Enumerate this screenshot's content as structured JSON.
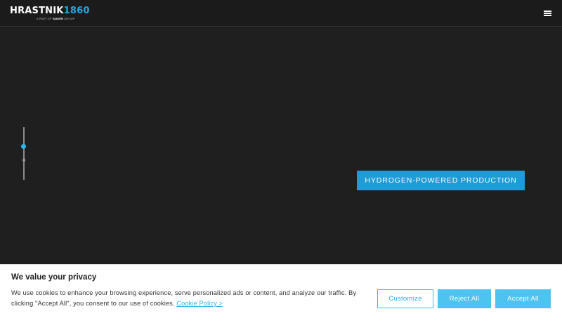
{
  "header": {
    "logo_word": "HRASTNIK",
    "logo_year": "1860",
    "logo_sub_before": "A PART OF ",
    "logo_sub_brand": "VAIDER",
    "logo_sub_after": " GROUP",
    "menu_icon": "hamburger-menu-icon"
  },
  "hero": {
    "button_label": "HYDROGEN-POWERED PRODUCTION",
    "slides_total": 2,
    "active_slide": 1
  },
  "cookie_banner": {
    "title": "We value your privacy",
    "text": "We use cookies to enhance your browsing experience, serve personalized ads or content, and analyze our traffic. By clicking \"Accept All\", you consent to our use of cookies.",
    "link_label": "Cookie Policy >",
    "customize_label": "Customize",
    "reject_label": "Reject All",
    "accept_label": "Accept All"
  },
  "colors": {
    "background": "#1f1f1f",
    "accent": "#1f9bd7",
    "cookie_button": "#4dc3ef"
  }
}
